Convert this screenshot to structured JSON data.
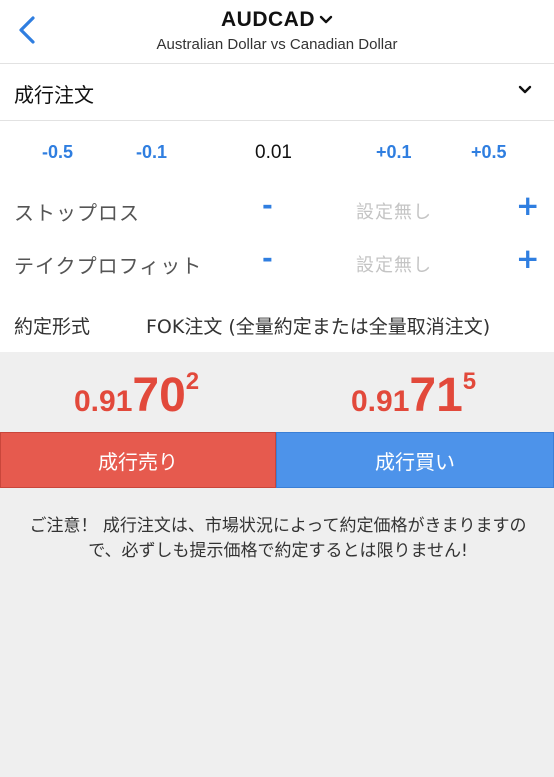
{
  "header": {
    "back_icon": "chevron-left-icon",
    "symbol": "AUDCAD",
    "symbol_dropdown_icon": "chevron-down-icon",
    "description": "Australian Dollar vs Canadian Dollar"
  },
  "order_type": {
    "label": "成行注文",
    "dropdown_icon": "chevron-down-icon"
  },
  "volume": {
    "minus_large": "-0.5",
    "minus_small": "-0.1",
    "value": "0.01",
    "plus_small": "+0.1",
    "plus_large": "+0.5"
  },
  "stop_loss": {
    "label": "ストップロス",
    "minus": "-",
    "value": "設定無し",
    "plus": "+"
  },
  "take_profit": {
    "label": "テイクプロフィット",
    "minus": "-",
    "value": "設定無し",
    "plus": "+"
  },
  "fill_policy": {
    "label": "約定形式",
    "value": "FOK注文 (全量約定または全量取消注文)"
  },
  "prices": {
    "bid": {
      "prefix": "0.91",
      "big": "70",
      "sup": "2"
    },
    "ask": {
      "prefix": "0.91",
      "big": "71",
      "sup": "5"
    }
  },
  "buttons": {
    "sell_label": "成行売り",
    "buy_label": "成行買い"
  },
  "notice": "ご注意！ 成行注文は、市場状況によって約定価格がきまりますので、必ずしも提示価格で約定するとは限りません!",
  "colors": {
    "accent": "#2f7ee0",
    "sell": "#e65a4e",
    "buy": "#4d93ea",
    "price": "#e2493b"
  }
}
